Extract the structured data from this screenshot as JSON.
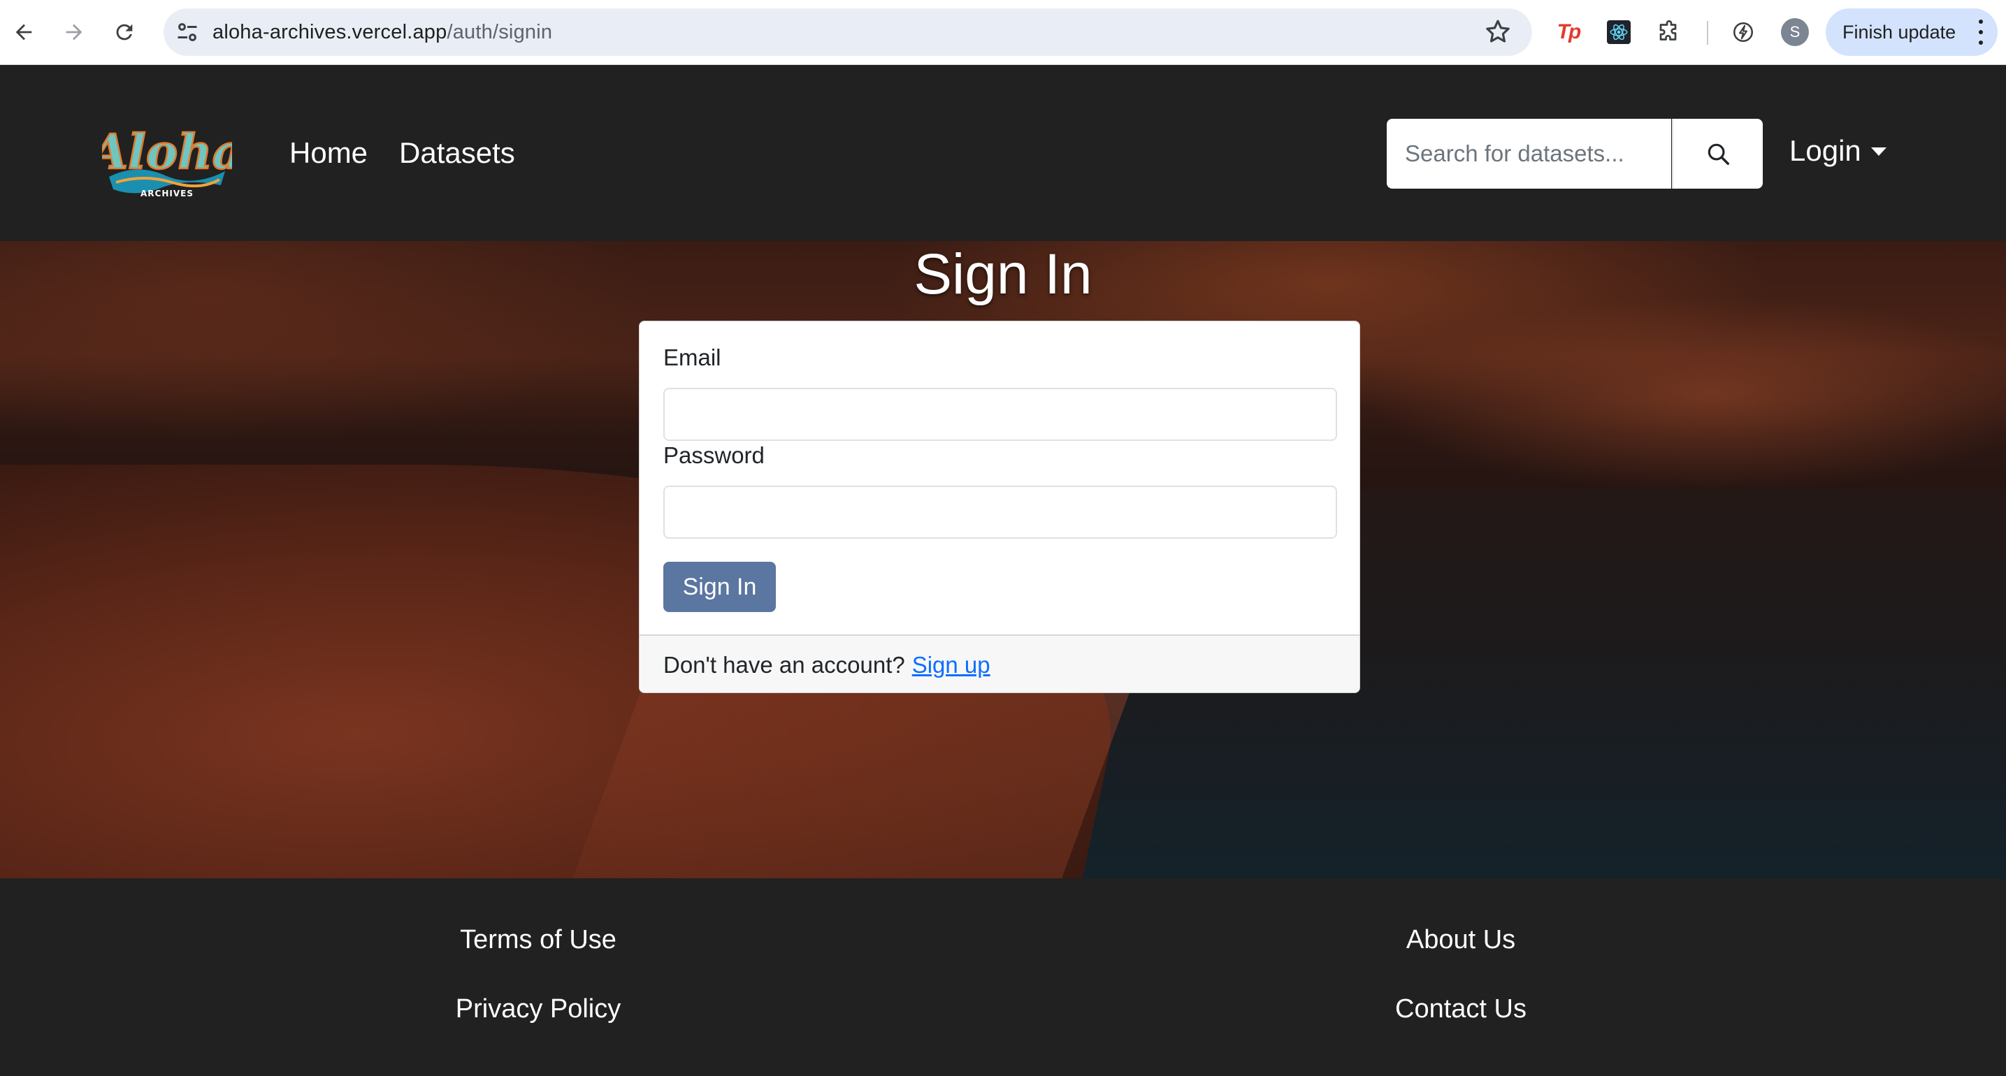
{
  "browser": {
    "url_host": "aloha-archives.vercel.app",
    "url_path": "/auth/signin",
    "profile_initial": "S",
    "update_label": "Finish update",
    "ext_tp_label": "Tp"
  },
  "header": {
    "logo_text": "Aloha",
    "logo_subtext": "ARCHIVES",
    "nav": [
      "Home",
      "Datasets"
    ],
    "search_placeholder": "Search for datasets...",
    "login_label": "Login"
  },
  "main": {
    "title": "Sign In",
    "email_label": "Email",
    "email_value": "",
    "password_label": "Password",
    "password_value": "",
    "submit_label": "Sign In",
    "footer_text": "Don't have an account?",
    "signup_link": "Sign up"
  },
  "footer": {
    "terms": "Terms of Use",
    "privacy": "Privacy Policy",
    "about": "About Us",
    "contact": "Contact Us"
  },
  "colors": {
    "header_bg": "#212121",
    "button_bg": "#5b76a0",
    "link": "#0d6efd",
    "update_pill": "#d3e3fd"
  }
}
